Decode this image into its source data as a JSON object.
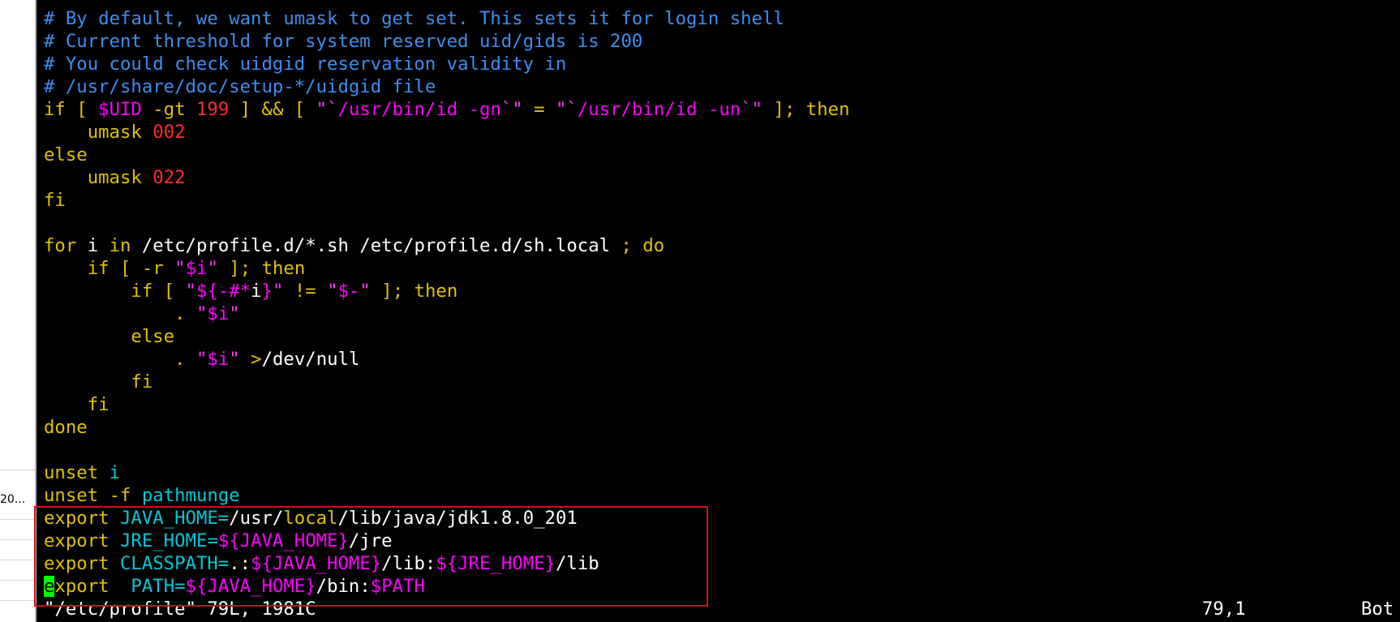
{
  "sidebar": {
    "row_label": "20..."
  },
  "editor": {
    "l1": "# By default, we want umask to get set. This sets it for login shell",
    "l2": "# Current threshold for system reserved uid/gids is 200",
    "l3": "# You could check uidgid reservation validity in",
    "l4": "# /usr/share/doc/setup-*/uidgid file",
    "l5": {
      "if": "if",
      "br1": " [ ",
      "uid": "$UID",
      "gt": " -gt ",
      "n199": "199",
      "mid": " ] && [ ",
      "q1": "\"`",
      "cmd1": "/usr/bin/id -gn",
      "q2": "`\"",
      "eq": " = ",
      "q3": "\"`",
      "cmd2": "/usr/bin/id -un",
      "q4": "`\"",
      "end": " ]; ",
      "then": "then"
    },
    "l6": {
      "indent": "    ",
      "kw": "umask",
      "sp": " ",
      "num": "002"
    },
    "l7": "else",
    "l8": {
      "indent": "    ",
      "kw": "umask",
      "sp": " ",
      "num": "022"
    },
    "l9": "fi",
    "l11": {
      "for": "for",
      "i": " i ",
      "in": "in",
      "paths": " /etc/profile.d/*.sh /etc/profile.d/sh.local ",
      "semi": ";",
      "sp": " ",
      "do": "do"
    },
    "l12": {
      "indent": "    ",
      "if": "if",
      "pre": " [ ",
      "r": "-r",
      "sp": " ",
      "q": "\"",
      "var": "$i",
      "q2": "\"",
      "post": " ]; ",
      "then": "then"
    },
    "l13": {
      "indent": "        ",
      "if": "if",
      "pre": " [ ",
      "q": "\"",
      "var1": "${-#*",
      "i": "i",
      "var1b": "}",
      "q2": "\"",
      "ne": " != ",
      "q3": "\"",
      "var2": "$-",
      "q4": "\"",
      "post": " ]; ",
      "then": "then"
    },
    "l14": {
      "indent": "            ",
      "dot": ".",
      "sp": " ",
      "q": "\"",
      "var": "$i",
      "q2": "\""
    },
    "l15": {
      "indent": "        ",
      "kw": "else"
    },
    "l16": {
      "indent": "            ",
      "dot": ".",
      "sp": " ",
      "q": "\"",
      "var": "$i",
      "q2": "\"",
      "sp2": " ",
      "redir": ">",
      "dest": "/dev/null"
    },
    "l17": {
      "indent": "        ",
      "kw": "fi"
    },
    "l18": {
      "indent": "    ",
      "kw": "fi"
    },
    "l19": "done",
    "l21": {
      "kw": "unset",
      "sp": " ",
      "arg": "i"
    },
    "l22": {
      "kw": "unset",
      "sp": " ",
      "flag": "-f",
      "sp2": " ",
      "arg": "pathmunge"
    },
    "l23": {
      "kw": "export",
      "sp": " ",
      "name": "JAVA_HOME=",
      "p1": "/usr/",
      "local": "local",
      "p2": "/lib/java/jdk1.8.0_201"
    },
    "l24": {
      "kw": "export",
      "sp": " ",
      "name": "JRE_HOME=",
      "var": "${JAVA_HOME}",
      "rest": "/jre"
    },
    "l25": {
      "kw": "export",
      "sp": " ",
      "name": "CLASSPATH=",
      "dot": ".:",
      "var1": "${JAVA_HOME}",
      "mid": "/lib:",
      "var2": "${JRE_HOME}",
      "rest": "/lib"
    },
    "l26": {
      "cursor_char": "e",
      "kw_rest": "xport",
      "sp": "  ",
      "name": "PATH=",
      "var1": "${JAVA_HOME}",
      "mid": "/bin:",
      "var2": "$PATH"
    }
  },
  "status": {
    "file": "\"/etc/profile\" 79L, 1981C",
    "position": "79,1",
    "scroll": "Bot"
  },
  "colors": {
    "comment": "#3d8ef0",
    "keyword": "#e0c000",
    "variable": "#ff00ff",
    "number": "#ff2b2b",
    "cyan": "#00c8d8",
    "cursor": "#00ff00",
    "highlight_box": "#d01010"
  }
}
